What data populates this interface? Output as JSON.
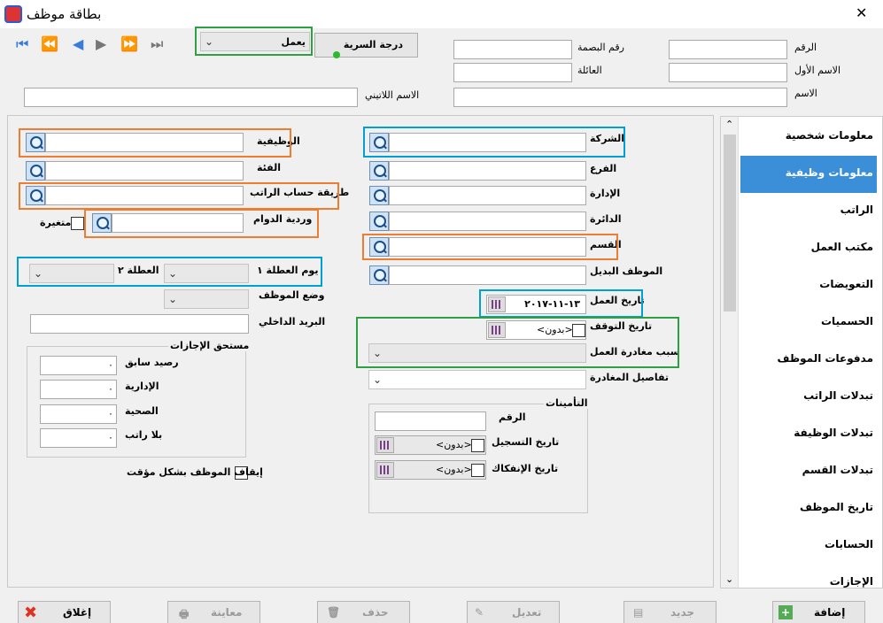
{
  "window": {
    "title": "بطاقة موظف",
    "close": "✕"
  },
  "header": {
    "status_value": "يعمل",
    "privacy_button": "درجة السرية",
    "number_label": "الرقم",
    "fingerprint_label": "رقم البصمة",
    "first_name_label": "الاسم الأول",
    "family_label": "العائلة",
    "name_label": "الاسم",
    "latin_name_label": "الاسم اللاتيني"
  },
  "job": {
    "job_title": "الوظيفية",
    "category": "الفئة",
    "salary_calc": "طريقة حساب الراتب",
    "shift": "وردية الدوام",
    "variable": "متغيرة",
    "holiday1": "يوم العطلة ١",
    "holiday2": "العطلة ٢",
    "employee_status": "وضع الموظف",
    "internal_mail": "البريد الداخلي",
    "company": "الشركة",
    "branch": "الفرع",
    "administration": "الإدارة",
    "department": "الدائرة",
    "section": "القسم",
    "substitute": "الموظف البديل",
    "work_date_label": "تاريخ العمل",
    "work_date_value": "١٣-١١-٢٠١٧",
    "stop_date_label": "تاريخ التوقف",
    "none_value": "<بدون>",
    "leave_reason": "سبب مغادرة العمل",
    "leave_details": "تفاصيل المغادرة",
    "stop_employee": "إيقاف الموظف بشكل مؤقت"
  },
  "leaves": {
    "title": "مستحق الإجازات",
    "previous": "رصيد سابق",
    "administrative": "الإدارية",
    "sick": "الصحية",
    "unpaid": "بلا راتب",
    "zero": "٠"
  },
  "insurance": {
    "title": "التأمينات",
    "number": "الرقم",
    "reg_date": "تاريخ التسجيل",
    "sep_date": "تاريخ الإنفكاك",
    "none_value": "<بدون>"
  },
  "sidebar": {
    "items": [
      {
        "label": "معلومات شخصية"
      },
      {
        "label": "معلومات وظيفية"
      },
      {
        "label": "الراتب"
      },
      {
        "label": "مكتب العمل"
      },
      {
        "label": "التعويضات"
      },
      {
        "label": "الحسميات"
      },
      {
        "label": "مدفوعات الموظف"
      },
      {
        "label": "تبدلات الراتب"
      },
      {
        "label": "تبدلات الوظيفة"
      },
      {
        "label": "تبدلات القسم"
      },
      {
        "label": "تاريخ الموظف"
      },
      {
        "label": "الحسابات"
      },
      {
        "label": "الإجازات"
      }
    ]
  },
  "footer": {
    "close": "إغلاق",
    "preview": "معاينة",
    "delete": "حذف",
    "edit": "تعديل",
    "new": "جديد",
    "add": "إضافة"
  },
  "colors": {
    "selected": "#3b8fd8",
    "orange": "#ed7d31",
    "blue": "#00a0d6",
    "green": "#2ea043"
  }
}
